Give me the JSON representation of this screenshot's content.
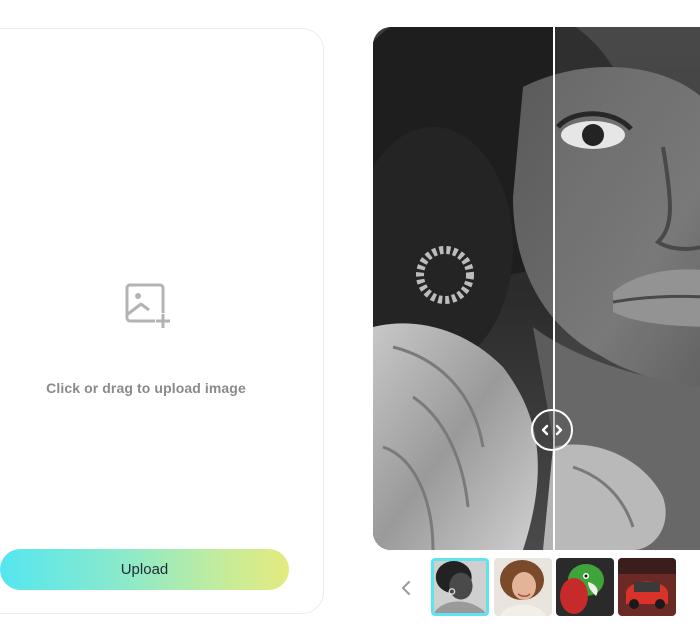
{
  "upload": {
    "drop_text": "Click or drag to upload image",
    "button_label": "Upload",
    "icon": "image-add-icon"
  },
  "preview": {
    "handle_icon": "compare-arrows-icon",
    "selected_thumbnail": 1
  },
  "carousel": {
    "prev_icon": "chevron-left-icon",
    "thumbnails": [
      {
        "name": "portrait-bw-woman"
      },
      {
        "name": "portrait-woman-smiling"
      },
      {
        "name": "parrot-green-red"
      },
      {
        "name": "red-car"
      }
    ]
  },
  "colors": {
    "accent_cyan": "#5ee4ee",
    "gradient_start": "#55e6f0",
    "gradient_end": "#e4ea7f",
    "text_gray": "#8a8a8a"
  }
}
